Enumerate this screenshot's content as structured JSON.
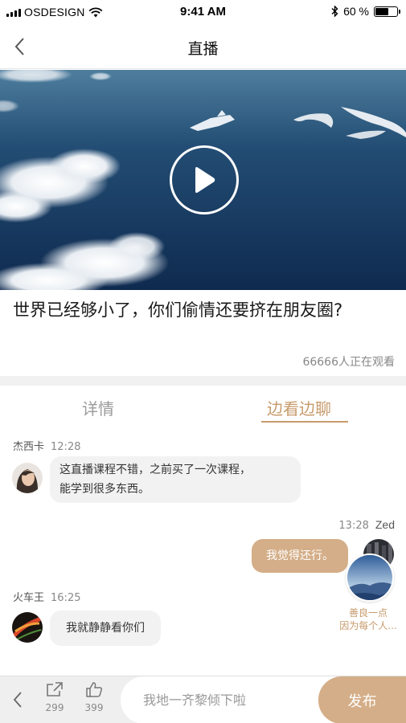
{
  "status_bar": {
    "carrier": "OSDESIGN",
    "time": "9:41 AM",
    "battery_percent": "60 %",
    "battery_level": 0.6
  },
  "nav": {
    "title": "直播"
  },
  "video": {
    "title": "世界已经够小了，你们偷情还要挤在朋友圈?",
    "viewers": "66666人正在观看"
  },
  "tabs": {
    "details": "详情",
    "chat": "边看边聊",
    "active": "chat"
  },
  "chat": {
    "messages": [
      {
        "name": "杰西卡",
        "time": "12:28",
        "text": "这直播课程不错，之前买了一次课程，能学到很多东西。",
        "line1": "这直播课程不错，之前买了一次课程，",
        "line2": "能学到很多东西。",
        "direction": "incoming"
      },
      {
        "name": "Zed",
        "time": "13:28",
        "text": "我觉得还行。",
        "direction": "outgoing"
      },
      {
        "name": "火车王",
        "time": "16:25",
        "text": "我就静静看你们",
        "direction": "incoming"
      }
    ]
  },
  "promo": {
    "line1": "善良一点",
    "line2": "因为每个人..."
  },
  "bottom_bar": {
    "share_count": "299",
    "like_count": "399",
    "input_placeholder": "我地一齐黎倾下啦",
    "publish_label": "发布"
  },
  "colors": {
    "accent": "#c79b6c",
    "bubble_out": "#d4ae88",
    "bubble_in": "#f2f2f2"
  }
}
